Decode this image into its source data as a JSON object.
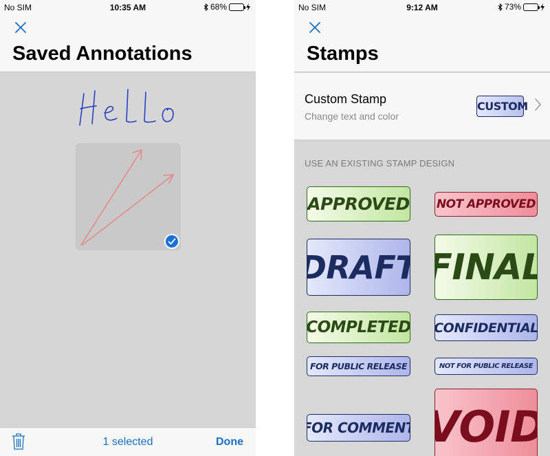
{
  "left": {
    "status": {
      "carrier": "No SIM",
      "time": "10:35 AM",
      "battery": "68%",
      "battery_level": 0.68
    },
    "title": "Saved Annotations",
    "annotation_text": "Hello",
    "toolbar": {
      "selected": "1 selected",
      "done": "Done"
    }
  },
  "right": {
    "status": {
      "carrier": "No SIM",
      "time": "9:12 AM",
      "battery": "73%",
      "battery_level": 0.73
    },
    "title": "Stamps",
    "custom": {
      "title": "Custom Stamp",
      "subtitle": "Change text and color",
      "stamp_label": "CUSTOM"
    },
    "section_header": "USE AN EXISTING STAMP DESIGN",
    "stamps": {
      "approved": "APPROVED",
      "not_approved": "NOT APPROVED",
      "draft": "DRAFT",
      "final": "FINAL",
      "completed": "COMPLETED",
      "confidential": "CONFIDENTIAL",
      "for_public_release": "FOR PUBLIC RELEASE",
      "not_for_public_release": "NOT FOR PUBLIC RELEASE",
      "for_comment": "FOR COMMENT",
      "void": "VOID"
    }
  },
  "colors": {
    "accent": "#1a6fc2",
    "check": "#1a6fd8",
    "ink_blue": "#2a3fc0",
    "arrow_red": "#e48a8a"
  }
}
